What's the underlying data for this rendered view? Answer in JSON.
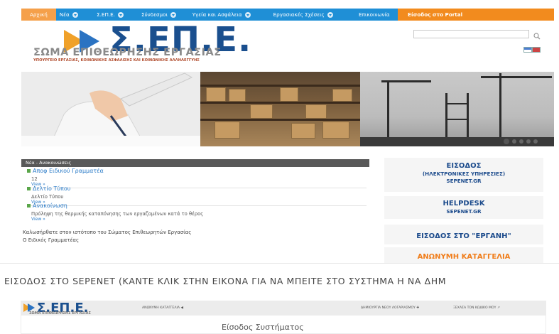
{
  "nav": {
    "items": [
      {
        "label": "Αρχική"
      },
      {
        "label": "Νέα"
      },
      {
        "label": "Σ.ΕΠ.Ε."
      },
      {
        "label": "Σύνδεσμοι"
      },
      {
        "label": "Υγεία και Ασφάλεια"
      },
      {
        "label": "Εργασιακές Σχέσεις"
      },
      {
        "label": "Επικοινωνία"
      },
      {
        "label": "Είσοδος στο Portal"
      }
    ]
  },
  "logo": {
    "main": "Σ.ΕΠ.Ε.",
    "sub": "ΣΩΜΑ ΕΠΙΘΕΩΡΗΣΗΣ ΕΡΓΑΣΙΑΣ",
    "ministry": "ΥΠΟΥΡΓΕΙΟ ΕΡΓΑΣΙΑΣ, ΚΟΙΝΩΝΙΚΗΣ ΑΣΦΑΛΙΣΗΣ ΚΑΙ ΚΟΙΝΩΝΙΚΗΣ ΑΛΛΗΛΕΓΓΥΗΣ"
  },
  "search": {
    "value": "",
    "placeholder": ""
  },
  "colors": {
    "nav": "#1f8fd6",
    "portal": "#f28b1e",
    "brand": "#1a4f8e",
    "anonymous": "#f07d1a"
  },
  "news": {
    "heading": "Νέα - Ανακοινώσεις",
    "items": [
      {
        "title": "Αποφ Ειδικού Γραμματέα",
        "body": "12",
        "more": "View »"
      },
      {
        "title": "Δελτίο Τύπου",
        "body": "Δελτίο Τύπου",
        "more": "View »"
      },
      {
        "title": "Ανακοίνωση",
        "body": "Πρόληψη της θερμικής καταπόνησης των εργαζομένων κατά το θέρος",
        "more": "View »"
      }
    ],
    "welcome": "Καλωσήρθατε στον ιστότοπο του Σώματος Επιθεωρητών Εργασίας",
    "signature": "Ο Ειδικός Γραμματέας"
  },
  "side": {
    "eisodos": {
      "title": "ΕΙΣΟΔΟΣ",
      "line2": "(ΗΛΕΚΤΡΟΝΙΚΕΣ ΥΠΗΡΕΣΙΕΣ)",
      "line3": "SEPENET.GR"
    },
    "helpdesk": {
      "title": "HELPDESK",
      "line2": "SEPENET.GR"
    },
    "ergani": "ΕΙΣΟΔΟΣ ΣΤΟ \"ΕΡΓΑΝΗ\"",
    "anonymous": "ΑΝΩΝΥΜΗ ΚΑΤΑΓΓΕΛΙΑ"
  },
  "sepenet": {
    "heading": "ΕΙΣΟΔΟΣ ΣΤΟ SEPENET (ΚΑΝΤΕ ΚΛΙΚ ΣΤΗΝ ΕΙΚΟΝΑ ΓΙΑ ΝΑ ΜΠΕΙΤΕ ΣΤΟ ΣΥΣΤΗΜΑ Η ΝΑ ΔΗΜ",
    "shot_logo": "Σ.ΕΠ.Ε.",
    "shot_sub": "ΣΩΜΑ ΕΠΙΘΕΩΡΗΣΗΣ ΕΡΓΑΣΙΑΣ",
    "link_anon": "ΑΝΩΝΥΜΗ ΚΑΤΑΓΓΕΛΙΑ",
    "link_create": "ΔΗΜΙΟΥΡΓΙΑ ΝΕΟΥ ΛΟΓΑΡΙΑΣΜΟΥ",
    "link_forgot": "ΞΕΧΑΣΑ ΤΟΝ ΚΩΔΙΚΟ ΜΟΥ",
    "title": "Είσοδος Συστήματος"
  }
}
